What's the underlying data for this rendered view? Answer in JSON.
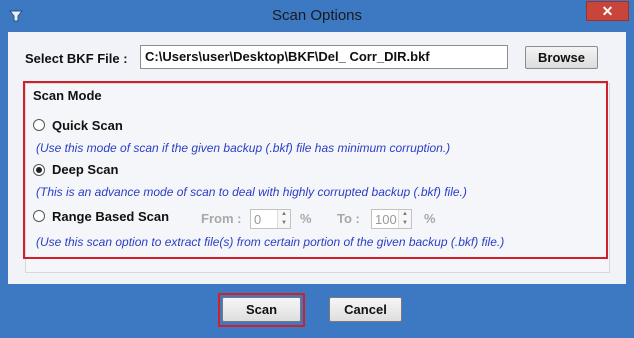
{
  "window": {
    "title": "Scan Options",
    "close_glyph": "✕",
    "app_icon": "tool-icon"
  },
  "bkf": {
    "label": "Select BKF File :",
    "path_value": "C:\\Users\\user\\Desktop\\BKF\\Del_ Corr_DIR.bkf",
    "browse_label": "Browse"
  },
  "scan_mode": {
    "title": "Scan Mode",
    "options": [
      {
        "label": "Quick Scan",
        "checked": false,
        "description": "(Use this mode of scan if the given backup (.bkf) file has minimum corruption.)"
      },
      {
        "label": "Deep Scan",
        "checked": true,
        "description": "(This is an advance mode of scan to deal with highly corrupted backup (.bkf) file.)"
      },
      {
        "label": "Range Based Scan",
        "checked": false,
        "description": "(Use this scan option to extract file(s) from certain portion of the given backup (.bkf) file.)"
      }
    ],
    "range": {
      "from_label": "From :",
      "from_value": "0",
      "to_label": "To :",
      "to_value": "100",
      "unit": "%"
    }
  },
  "footer": {
    "scan_label": "Scan",
    "cancel_label": "Cancel"
  },
  "colors": {
    "titlebar": "#3c79c2",
    "highlight": "#d0212b",
    "description_text": "#2a3ec4",
    "close_button": "#c7453a"
  }
}
